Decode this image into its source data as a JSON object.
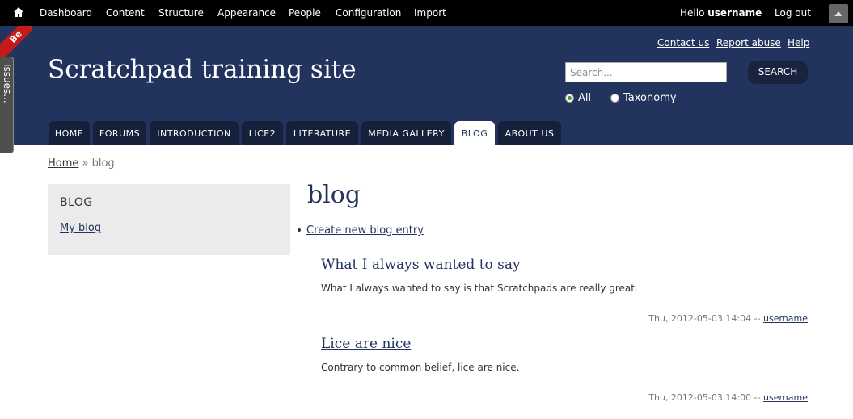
{
  "toolbar": {
    "items": [
      "Dashboard",
      "Content",
      "Structure",
      "Appearance",
      "People",
      "Configuration",
      "Import"
    ],
    "hello_prefix": "Hello ",
    "username": "username",
    "logout": "Log out"
  },
  "corner_ribbon": "Be",
  "issues_tab": "Issues...",
  "header": {
    "links": [
      "Contact us",
      "Report abuse",
      "Help"
    ],
    "site_name": "Scratchpad training site",
    "search": {
      "placeholder": "Search...",
      "button": "SEARCH",
      "options": [
        "All",
        "Taxonomy"
      ],
      "selected": "All"
    }
  },
  "nav": {
    "tabs": [
      "HOME",
      "FORUMS",
      "INTRODUCTION",
      "LICE2",
      "LITERATURE",
      "MEDIA GALLERY",
      "BLOG",
      "ABOUT US"
    ],
    "active": "BLOG"
  },
  "breadcrumb": {
    "home": "Home",
    "separator": " » ",
    "current": "blog"
  },
  "sidebar": {
    "title": "BLOG",
    "link": "My blog"
  },
  "main": {
    "title": "blog",
    "create_link": "Create new blog entry",
    "posts": [
      {
        "title": "What I always wanted to say",
        "body": "What I always wanted to say is that Scratchpads are really great.",
        "date": "Thu, 2012-05-03 14:04 -- ",
        "author": "username"
      },
      {
        "title": "Lice are nice",
        "body": "Contrary to common belief, lice are nice.",
        "date": "Thu, 2012-05-03 14:00 -- ",
        "author": "username"
      }
    ]
  },
  "colors": {
    "header_bg": "#22345d",
    "tab_bg": "#15203b",
    "toolbar_bg": "#000000",
    "sidebar_bg": "#ebebeb"
  }
}
